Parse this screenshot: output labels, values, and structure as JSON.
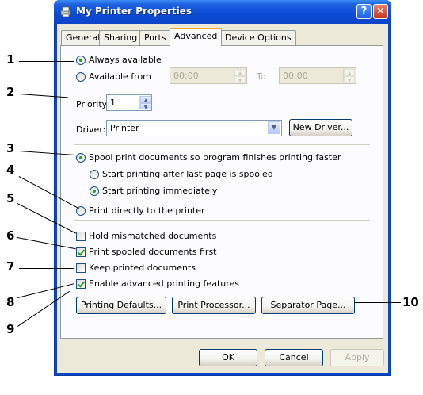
{
  "window": {
    "title": "My Printer Properties",
    "help_glyph": "?",
    "close_glyph": "✕"
  },
  "tabs": [
    {
      "label": "General",
      "active": false
    },
    {
      "label": "Sharing",
      "active": false
    },
    {
      "label": "Ports",
      "active": false
    },
    {
      "label": "Advanced",
      "active": true
    },
    {
      "label": "Device Options",
      "active": false
    }
  ],
  "availability": {
    "always_label": "Always available",
    "from_label": "Available from",
    "from_value": "00:00",
    "to_label": "To",
    "to_value": "00:00",
    "selected": "always"
  },
  "priority": {
    "label": "Priority:",
    "value": "1"
  },
  "driver": {
    "label": "Driver:",
    "value": "Printer",
    "new_driver_label": "New Driver..."
  },
  "spool": {
    "spool_label": "Spool print documents so program finishes printing faster",
    "after_last_label": "Start printing after last page is spooled",
    "immediately_label": "Start printing immediately",
    "direct_label": "Print directly to the printer"
  },
  "options": {
    "hold_mismatched": {
      "label": "Hold mismatched documents",
      "checked": false
    },
    "print_spooled_first": {
      "label": "Print spooled documents first",
      "checked": true
    },
    "keep_printed": {
      "label": "Keep printed documents",
      "checked": false
    },
    "enable_advanced": {
      "label": "Enable advanced printing features",
      "checked": true
    }
  },
  "buttons": {
    "printing_defaults": "Printing Defaults...",
    "print_processor": "Print Processor...",
    "separator_page": "Separator Page...",
    "ok": "OK",
    "cancel": "Cancel",
    "apply": "Apply"
  },
  "callouts": [
    "1",
    "2",
    "3",
    "4",
    "5",
    "6",
    "7",
    "8",
    "9",
    "10"
  ],
  "colors": {
    "titlebar": "#0b45c8",
    "dialog_face": "#ece9d8",
    "check_green": "#21a121",
    "active_tab_accent": "#f7a532"
  }
}
